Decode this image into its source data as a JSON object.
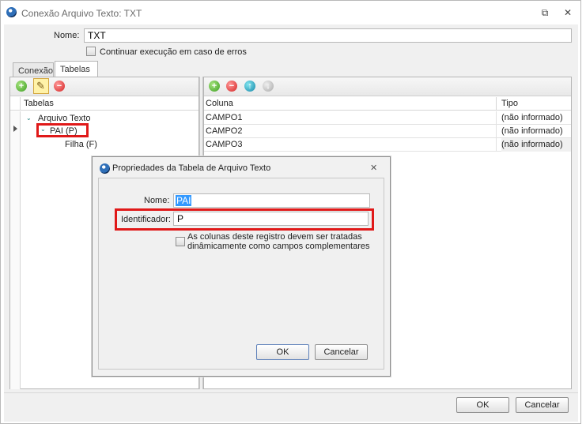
{
  "window": {
    "title": "Conexão Arquivo Texto: TXT",
    "icons": [
      "app-logo-icon",
      "restore-window-icon",
      "close-icon"
    ],
    "restore_glyph": "⧉",
    "close_glyph": "✕"
  },
  "form": {
    "name_label": "Nome:",
    "name_value": "TXT",
    "continue_label": "Continuar execução em caso de erros"
  },
  "tabs": [
    {
      "label": "Conexão"
    },
    {
      "label": "Tabelas"
    }
  ],
  "left_panel": {
    "toolbar_icons": [
      "add-table-icon",
      "edit-table-icon",
      "remove-table-icon"
    ],
    "toolbar_glyphs": [
      "+",
      "✎",
      "−"
    ],
    "header": "Tabelas",
    "tree": [
      {
        "label": "Arquivo Texto"
      },
      {
        "label": "PAI (P)"
      },
      {
        "label": "Filha (F)"
      }
    ]
  },
  "right_panel": {
    "toolbar_icons": [
      "add-column-icon",
      "remove-column-icon",
      "move-up-icon",
      "move-down-icon"
    ],
    "toolbar_glyphs": [
      "+",
      "−",
      "↑",
      "↓"
    ],
    "columns": [
      "Coluna",
      "Tipo"
    ],
    "rows": [
      {
        "coluna": "CAMPO1",
        "tipo": "(não informado)"
      },
      {
        "coluna": "CAMPO2",
        "tipo": "(não informado)"
      },
      {
        "coluna": "CAMPO3",
        "tipo": "(não informado)"
      }
    ]
  },
  "dialog": {
    "title": "Propriedades da Tabela de Arquivo Texto",
    "close_glyph": "✕",
    "name_label": "Nome:",
    "name_value": "PAI",
    "identifier_label": "Identificador:",
    "identifier_value": "P",
    "dynamic_label_line1": "As colunas deste registro devem ser tratadas",
    "dynamic_label_line2": "dinâmicamente como campos complementares",
    "ok_label": "OK",
    "cancel_label": "Cancelar"
  },
  "footer": {
    "ok_label": "OK",
    "cancel_label": "Cancelar"
  },
  "colors": {
    "highlight": "#e01919",
    "selection": "#3399ff"
  }
}
